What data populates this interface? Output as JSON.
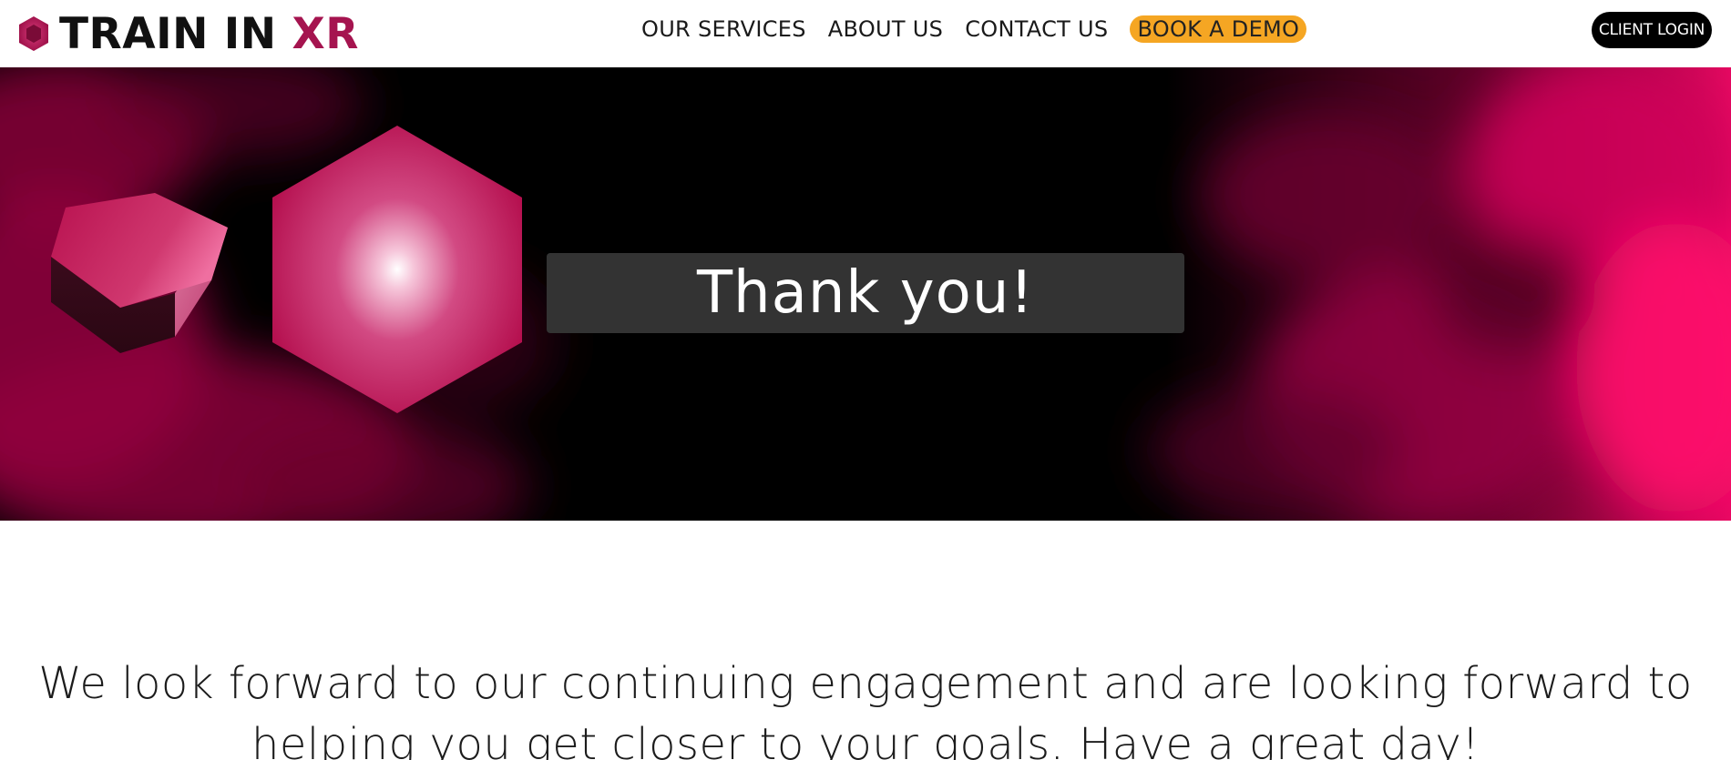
{
  "brand": {
    "name_main": "TRAIN IN ",
    "name_accent": "XR",
    "accent_color": "#a5144f",
    "logo_icon": "hexagon-icon"
  },
  "nav": {
    "items": [
      {
        "label": "OUR SERVICES"
      },
      {
        "label": "ABOUT US"
      },
      {
        "label": "CONTACT US"
      }
    ],
    "cta": {
      "label": "BOOK A DEMO",
      "color": "#f5a623"
    },
    "login": {
      "label": "CLIENT LOGIN"
    }
  },
  "hero": {
    "heading": "Thank you!",
    "colors": {
      "background": "#000000",
      "magenta": "#e0005f",
      "panel": "#333333"
    },
    "decor_icons": [
      "hexagonal-prism-icon",
      "glowing-hexagon-icon"
    ]
  },
  "message": {
    "text": "We look forward to our continuing engagement and are looking forward to helping you get closer to your goals. Have a great day!"
  }
}
